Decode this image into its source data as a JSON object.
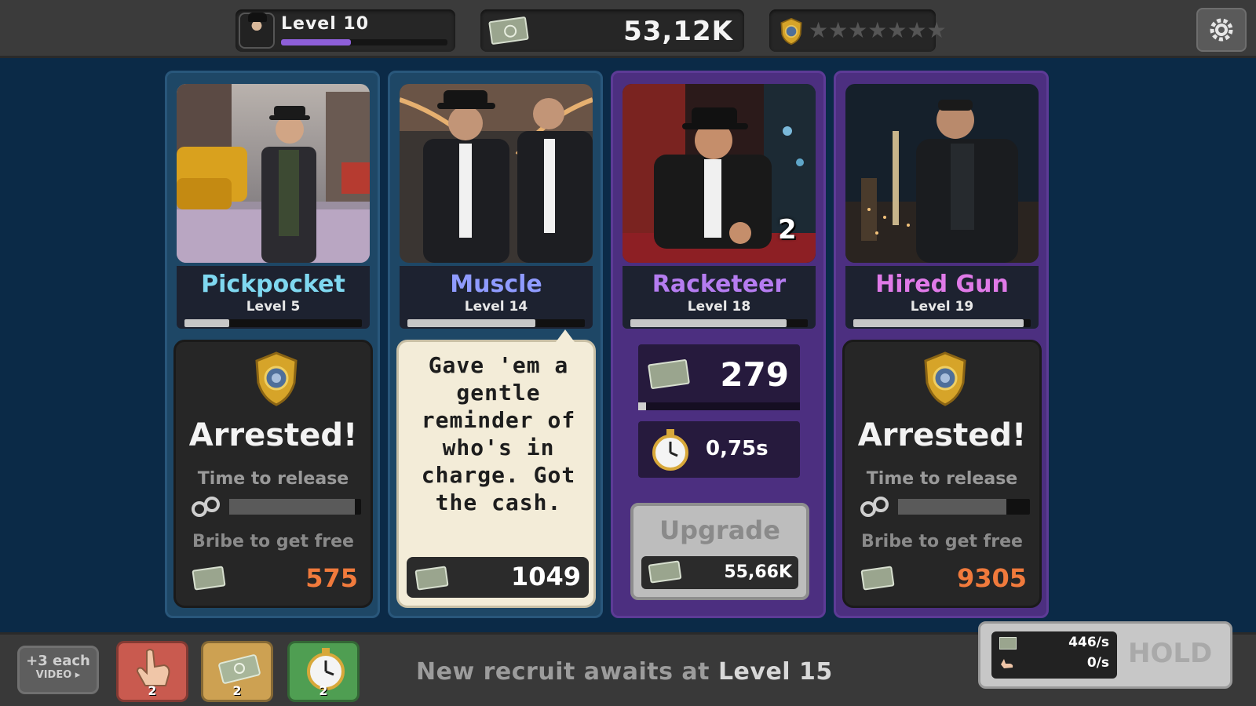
{
  "topbar": {
    "level_label": "Level 10",
    "xp_progress": 0.42,
    "cash": "53,12K",
    "stars_total": 7,
    "stars_filled": 0,
    "settings_icon": "gear-icon"
  },
  "cards": [
    {
      "name": "Pickpocket",
      "name_color": "#7fd8f0",
      "level": "Level 5",
      "level_progress": 0.25,
      "state": "arrested",
      "arrested_title": "Arrested!",
      "release_label": "Time to release",
      "release_progress": 0.95,
      "bribe_label": "Bribe to get free",
      "bribe_cost": "575"
    },
    {
      "name": "Muscle",
      "name_color": "#8f9bff",
      "level": "Level 14",
      "level_progress": 0.72,
      "state": "speech",
      "speech": "Gave 'em a gentle reminder of who's in charge. Got the cash.",
      "cash_reward": "1049"
    },
    {
      "name": "Racketeer",
      "name_color": "#b57cf0",
      "level": "Level 18",
      "level_progress": 0.88,
      "state": "working",
      "multiplier": "2",
      "income": "279",
      "income_progress": 0.05,
      "cycle_time": "0,75s",
      "upgrade_label": "Upgrade",
      "upgrade_cost": "55,66K"
    },
    {
      "name": "Hired Gun",
      "name_color": "#e07ae8",
      "level": "Level 19",
      "level_progress": 0.96,
      "state": "arrested",
      "arrested_title": "Arrested!",
      "release_label": "Time to release",
      "release_progress": 0.82,
      "bribe_label": "Bribe to get free",
      "bribe_cost": "9305"
    }
  ],
  "bottombar": {
    "video_top": "+3 each",
    "video_bottom": "VIDEO ▸",
    "boosts": [
      {
        "icon": "tap-hand-icon",
        "count": "2",
        "color": "#c95a4f"
      },
      {
        "icon": "cash-stack-icon",
        "count": "2",
        "color": "#cda152"
      },
      {
        "icon": "stopwatch-icon",
        "count": "2",
        "color": "#4f9e52"
      }
    ],
    "recruit_prefix": "New recruit awaits at",
    "recruit_level": "Level 15",
    "rate_cash": "446/s",
    "rate_tap": "0/s",
    "hold_label": "HOLD"
  }
}
